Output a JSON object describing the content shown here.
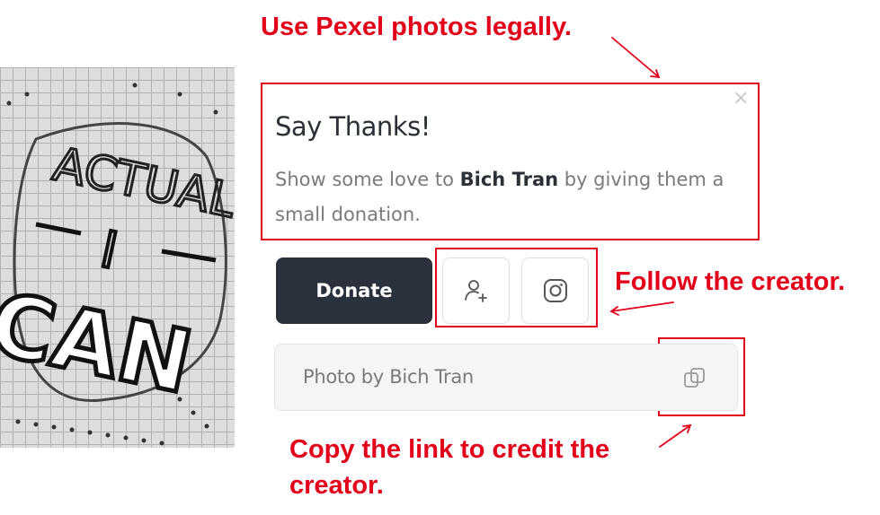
{
  "annotations": {
    "title": "Use Pexel photos legally.",
    "follow": "Follow the creator.",
    "copy_line1": "Copy the link to credit the",
    "copy_line2": "creator."
  },
  "photo": {
    "lettering": [
      "ACTUAL",
      "I",
      "CAN"
    ]
  },
  "card": {
    "close_symbol": "×",
    "title": "Say Thanks!",
    "body_prefix": "Show some love to ",
    "creator": "Bich Tran",
    "body_suffix": " by giving them a small donation."
  },
  "actions": {
    "donate_label": "Donate",
    "follow_icon": "user-plus-icon",
    "instagram_icon": "instagram-icon"
  },
  "credit": {
    "text": "Photo by Bich Tran",
    "copy_icon": "copy-icon"
  },
  "colors": {
    "annotation": "#e3001b",
    "donate_bg": "#2b313c",
    "text_dark": "#2b2f36",
    "text_muted": "#7a7a7a"
  }
}
